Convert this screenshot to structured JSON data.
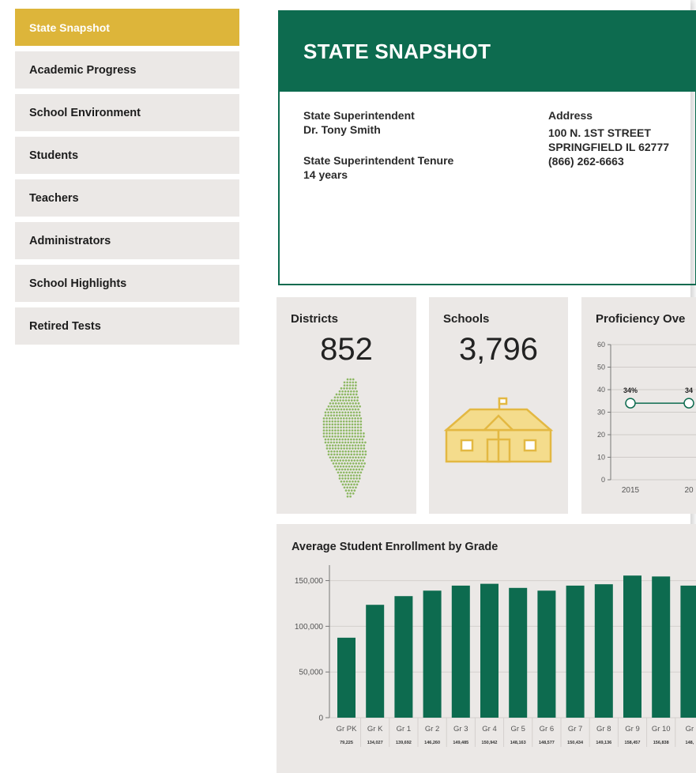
{
  "sidebar": {
    "items": [
      {
        "label": "State Snapshot",
        "active": true
      },
      {
        "label": "Academic Progress"
      },
      {
        "label": "School Environment"
      },
      {
        "label": "Students"
      },
      {
        "label": "Teachers"
      },
      {
        "label": "Administrators"
      },
      {
        "label": "School Highlights"
      },
      {
        "label": "Retired Tests"
      }
    ]
  },
  "snapshot": {
    "title": "STATE SNAPSHOT",
    "superintendent_label": "State Superintendent",
    "superintendent_name": "Dr. Tony Smith",
    "tenure_label": "State Superintendent Tenure",
    "tenure_value": "14 years",
    "address_label": "Address",
    "address_line1": "100 N. 1ST STREET",
    "address_line2": "SPRINGFIELD IL 62777",
    "phone": "(866) 262-6663"
  },
  "stats": {
    "districts_label": "Districts",
    "districts_value": "852",
    "schools_label": "Schools",
    "schools_value": "3,796",
    "proficiency_label": "Proficiency Ove"
  },
  "colors": {
    "brand_green": "#0d6b4f",
    "nav_active": "#ddb53a",
    "panel_bg": "#ebe8e6",
    "state_dots": "#8db863",
    "school_icon": "#e3b842"
  },
  "icons": {
    "districts": "illinois-state-dot-map-icon",
    "schools": "schoolhouse-icon"
  },
  "chart_data": [
    {
      "type": "line",
      "title": "Proficiency Ove",
      "x": [
        "2015",
        "20"
      ],
      "series": [
        {
          "values": [
            34,
            34
          ]
        }
      ],
      "data_labels": [
        "34%",
        "34"
      ],
      "y_ticks": [
        "0",
        "10",
        "20",
        "30",
        "40",
        "50",
        "60"
      ],
      "ylim": [
        0,
        60
      ],
      "grid": true
    },
    {
      "type": "bar",
      "title": "Average Student Enrollment by Grade",
      "categories": [
        "Gr PK",
        "Gr K",
        "Gr 1",
        "Gr 2",
        "Gr 3",
        "Gr 4",
        "Gr 5",
        "Gr 6",
        "Gr 7",
        "Gr 8",
        "Gr 9",
        "Gr 10",
        "Gr"
      ],
      "values": [
        87500,
        123500,
        133000,
        139000,
        144500,
        146500,
        142000,
        139000,
        144500,
        146000,
        155500,
        154500,
        144500
      ],
      "value_labels": [
        "79,225",
        "134,027",
        "139,692",
        "146,260",
        "149,485",
        "150,942",
        "148,163",
        "148,577",
        "150,434",
        "149,136",
        "158,457",
        "156,838",
        "148,"
      ],
      "y_ticks": [
        "0",
        "50,000",
        "100,000",
        "150,000"
      ],
      "ylim": [
        0,
        160000
      ],
      "grid": true
    }
  ]
}
